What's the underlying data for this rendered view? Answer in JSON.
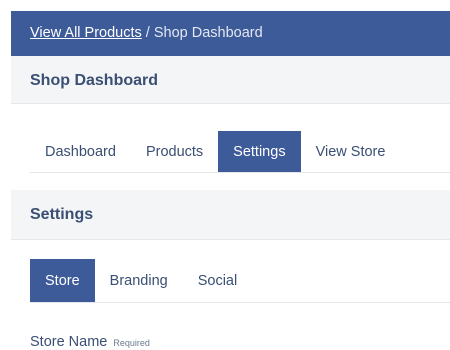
{
  "breadcrumb": {
    "link_label": "View All Products",
    "separator": "/",
    "current": "Shop Dashboard"
  },
  "dashboard": {
    "title": "Shop Dashboard",
    "tabs": [
      {
        "label": "Dashboard",
        "active": false
      },
      {
        "label": "Products",
        "active": false
      },
      {
        "label": "Settings",
        "active": true
      },
      {
        "label": "View Store",
        "active": false
      }
    ]
  },
  "settings": {
    "title": "Settings",
    "tabs": [
      {
        "label": "Store",
        "active": true
      },
      {
        "label": "Branding",
        "active": false
      },
      {
        "label": "Social",
        "active": false
      }
    ],
    "store_name_label": "Store Name",
    "required_label": "Required"
  },
  "colors": {
    "accent": "#3d5a99",
    "heading_text": "#3a4f73",
    "panel_background": "#f4f5f7"
  }
}
